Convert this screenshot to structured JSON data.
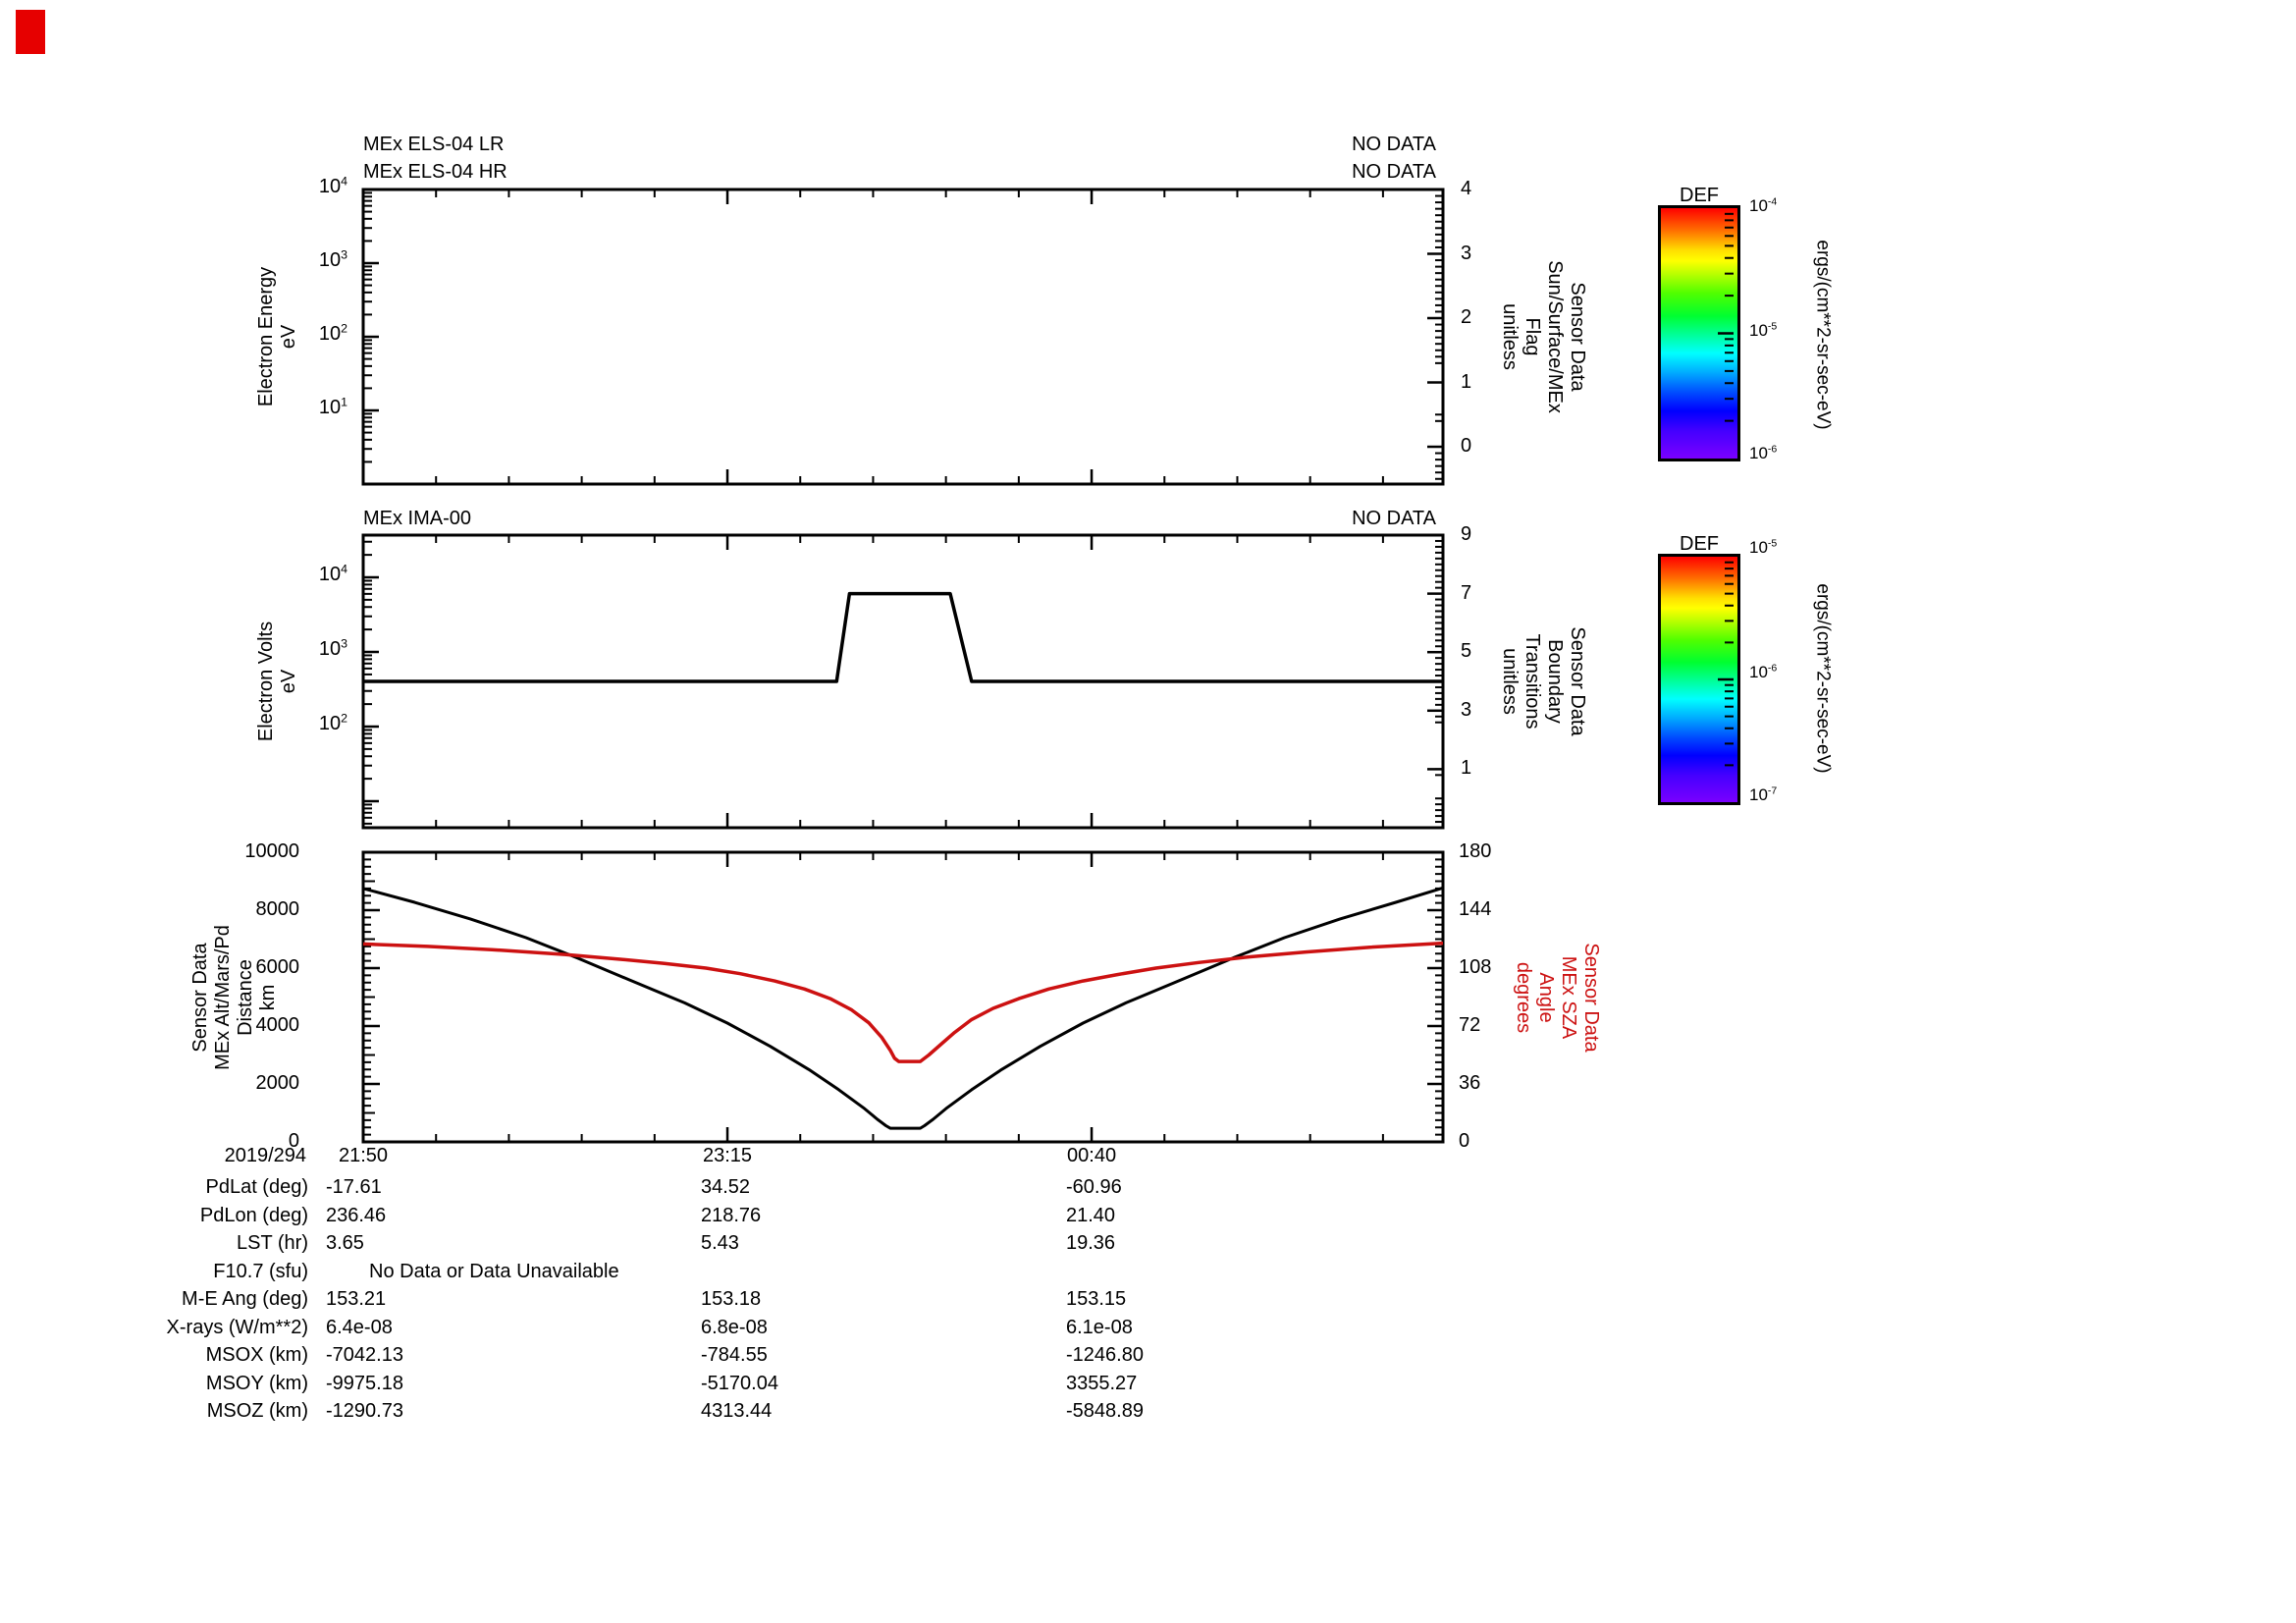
{
  "marker_color": "#e60000",
  "accent_red": "#cc1111",
  "time_axis": {
    "date_label": "2019/294",
    "majors": [
      {
        "t": 0,
        "label": "21:50"
      },
      {
        "t": 85,
        "label": "23:15"
      },
      {
        "t": 170,
        "label": "00:40"
      }
    ],
    "minor_step": 17,
    "t_max": 252
  },
  "panels": [
    {
      "id": "els",
      "titles": [
        "MEx ELS-04 LR",
        "MEx ELS-04 HR"
      ],
      "no_data": [
        "NO DATA",
        "NO DATA"
      ],
      "left_title": "Electron Energy\neV",
      "right_title": "Sensor Data\nSun/Surface/MEx\nFlag\nunitless"
    },
    {
      "id": "ima",
      "titles": [
        "MEx IMA-00"
      ],
      "no_data": [
        "NO DATA"
      ],
      "left_title": "Electron Volts\neV",
      "right_title": "Sensor Data\nBoundary\nTransitions\nunitless"
    },
    {
      "id": "ephemeris",
      "titles": [],
      "no_data": [],
      "left_title": "Sensor Data\nMEx Alt/Mars/Pd\nDistance\nkm",
      "right_title": "Sensor Data\nMEx SZA\nAngle\ndegrees",
      "right_title_color": "#cc1111"
    }
  ],
  "colorbars": [
    {
      "title": "DEF",
      "unit": "ergs/(cm**2-sr-sec-eV)",
      "tick_labels": [
        {
          "base": "10",
          "exp": "-4"
        },
        {
          "base": "10",
          "exp": "-5"
        },
        {
          "base": "10",
          "exp": "-6"
        }
      ]
    },
    {
      "title": "DEF",
      "unit": "ergs/(cm**2-sr-sec-eV)",
      "tick_labels": [
        {
          "base": "10",
          "exp": "-5"
        },
        {
          "base": "10",
          "exp": "-6"
        },
        {
          "base": "10",
          "exp": "-7"
        }
      ]
    }
  ],
  "gradient_stops": [
    "#ff0000 0%",
    "#ff7000 9%",
    "#ffe000 17%",
    "#ffff00 21%",
    "#b0ff00 27%",
    "#50ff00 34%",
    "#00ff30 43%",
    "#00ff90 50%",
    "#00ffff 58%",
    "#00a8ff 66%",
    "#0048ff 74%",
    "#0000ff 81%",
    "#4400ff 89%",
    "#7a00ff 100%"
  ],
  "chart_data": [
    {
      "type": "line",
      "title": "MEx ELS-04 LR / MEx ELS-04 HR",
      "status": "NO DATA",
      "x": {
        "unit": "minutes since 21:50",
        "range": [
          0,
          252
        ],
        "major_ticks": [
          0,
          85,
          170
        ],
        "tick_labels": [
          "21:50",
          "23:15",
          "00:40"
        ]
      },
      "y_left": {
        "scale": "log",
        "label": "Electron Energy (eV)",
        "range": [
          1,
          10000
        ],
        "tick_labels": [
          {
            "e": 4,
            "base": "10",
            "exp": "4"
          },
          {
            "e": 3,
            "base": "10",
            "exp": "3"
          },
          {
            "e": 2,
            "base": "10",
            "exp": "2"
          },
          {
            "e": 1,
            "base": "10",
            "exp": "1"
          }
        ]
      },
      "y_right": {
        "scale": "linear",
        "label": "Sensor Data Sun/Surface/MEx Flag (unitless)",
        "range": [
          -0.58,
          4
        ],
        "ticks": [
          4,
          3,
          2,
          1,
          0
        ],
        "minor": 0.1
      },
      "series": []
    },
    {
      "type": "line",
      "title": "MEx IMA-00",
      "status": "NO DATA",
      "x": {
        "unit": "minutes since 21:50",
        "range": [
          0,
          252
        ],
        "major_ticks": [
          0,
          85,
          170
        ],
        "tick_labels": [
          "21:50",
          "23:15",
          "00:40"
        ]
      },
      "y_left": {
        "scale": "log",
        "label": "Electron Volts (eV)",
        "range": [
          4.4,
          36800
        ],
        "tick_labels": [
          {
            "e": 4,
            "base": "10",
            "exp": "4"
          },
          {
            "e": 3,
            "base": "10",
            "exp": "3"
          },
          {
            "e": 2,
            "base": "10",
            "exp": "2"
          }
        ]
      },
      "y_right": {
        "scale": "linear",
        "label": "Sensor Data Boundary Transitions (unitless)",
        "range": [
          -1,
          9
        ],
        "ticks": [
          9,
          7,
          5,
          3,
          1
        ],
        "minor": 0.2
      },
      "series": [
        {
          "name": "boundary-transitions",
          "axis": "right",
          "color": "#000000",
          "width": 3.5,
          "points": [
            [
              0,
              4
            ],
            [
              110.5,
              4
            ],
            [
              113.5,
              7
            ],
            [
              137,
              7
            ],
            [
              142,
              4
            ],
            [
              252,
              4
            ]
          ]
        }
      ]
    },
    {
      "type": "line",
      "title": "Ephemeris",
      "x": {
        "unit": "minutes since 21:50",
        "range": [
          0,
          252
        ],
        "major_ticks": [
          0,
          85,
          170
        ],
        "tick_labels": [
          "21:50",
          "23:15",
          "00:40"
        ]
      },
      "y_left": {
        "scale": "linear",
        "label": "Sensor Data MEx Alt/Mars/Pd Distance (km)",
        "range": [
          0,
          10000
        ],
        "ticks": [
          10000,
          8000,
          6000,
          4000,
          2000,
          0
        ],
        "minor": 250
      },
      "y_right": {
        "scale": "linear",
        "label": "Sensor Data MEx SZA Angle (degrees)",
        "range": [
          0,
          180
        ],
        "ticks": [
          180,
          144,
          108,
          72,
          36,
          0
        ],
        "minor": 4.5
      },
      "series": [
        {
          "name": "mex-altitude-km",
          "axis": "left",
          "color": "#000000",
          "width": 3,
          "points": [
            [
              0,
              8750
            ],
            [
              12,
              8270
            ],
            [
              25,
              7700
            ],
            [
              38,
              7050
            ],
            [
              50,
              6350
            ],
            [
              62,
              5600
            ],
            [
              75,
              4800
            ],
            [
              85,
              4100
            ],
            [
              95,
              3300
            ],
            [
              104,
              2500
            ],
            [
              111,
              1800
            ],
            [
              117,
              1150
            ],
            [
              120,
              780
            ],
            [
              122,
              560
            ],
            [
              123,
              470
            ],
            [
              130,
              470
            ],
            [
              131,
              560
            ],
            [
              133,
              780
            ],
            [
              136,
              1150
            ],
            [
              142,
              1800
            ],
            [
              149,
              2500
            ],
            [
              158,
              3300
            ],
            [
              168,
              4100
            ],
            [
              178,
              4800
            ],
            [
              191,
              5600
            ],
            [
              203,
              6350
            ],
            [
              215,
              7050
            ],
            [
              228,
              7700
            ],
            [
              241,
              8270
            ],
            [
              252,
              8770
            ]
          ]
        },
        {
          "name": "mex-sza-degrees",
          "axis": "right",
          "color": "#cc1111",
          "width": 3.5,
          "points": [
            [
              0,
              123
            ],
            [
              15,
              121.5
            ],
            [
              30,
              119.5
            ],
            [
              47,
              116.5
            ],
            [
              60,
              113.5
            ],
            [
              70,
              111
            ],
            [
              80,
              108
            ],
            [
              88,
              104.5
            ],
            [
              96,
              100
            ],
            [
              103,
              95
            ],
            [
              109,
              89
            ],
            [
              114,
              82
            ],
            [
              118,
              74
            ],
            [
              121,
              65
            ],
            [
              123,
              57
            ],
            [
              124,
              52
            ],
            [
              125,
              50
            ],
            [
              130,
              50
            ],
            [
              132,
              54
            ],
            [
              135,
              61
            ],
            [
              138,
              68
            ],
            [
              142,
              76
            ],
            [
              147,
              83
            ],
            [
              153,
              89
            ],
            [
              160,
              95
            ],
            [
              168,
              100
            ],
            [
              176,
              104
            ],
            [
              185,
              108
            ],
            [
              195,
              111.5
            ],
            [
              207,
              115
            ],
            [
              220,
              118
            ],
            [
              235,
              121
            ],
            [
              252,
              123.5
            ]
          ]
        }
      ]
    }
  ],
  "table": {
    "rows": [
      {
        "label": "PdLat (deg)",
        "c1": "-17.61",
        "c2": "34.52",
        "c3": "-60.96"
      },
      {
        "label": "PdLon (deg)",
        "c1": "236.46",
        "c2": "218.76",
        "c3": "21.40"
      },
      {
        "label": "LST (hr)",
        "c1": "3.65",
        "c2": "5.43",
        "c3": "19.36"
      },
      {
        "label": "F10.7 (sfu)",
        "span": "No Data or Data Unavailable"
      },
      {
        "label": "M-E Ang (deg)",
        "c1": "153.21",
        "c2": "153.18",
        "c3": "153.15"
      },
      {
        "label": "X-rays (W/m**2)",
        "c1": "6.4e-08",
        "c2": "6.8e-08",
        "c3": "6.1e-08"
      },
      {
        "label": "MSOX (km)",
        "c1": "-7042.13",
        "c2": "-784.55",
        "c3": "-1246.80"
      },
      {
        "label": "MSOY (km)",
        "c1": "-9975.18",
        "c2": "-5170.04",
        "c3": "3355.27"
      },
      {
        "label": "MSOZ (km)",
        "c1": "-1290.73",
        "c2": "4313.44",
        "c3": "-5848.89"
      }
    ]
  }
}
